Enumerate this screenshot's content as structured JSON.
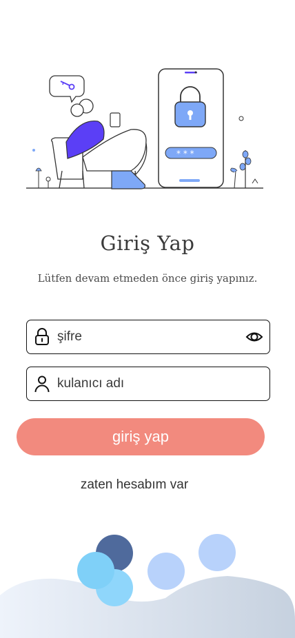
{
  "login": {
    "title": "Giriş Yap",
    "subtitle": "Lütfen devam etmeden önce giriş yapınız.",
    "password_placeholder": "şifre",
    "username_placeholder": "kulanıcı adı",
    "submit_label": "giriş yap",
    "have_account_label": "zaten hesabım var"
  },
  "icons": {
    "password": "lock-icon",
    "visibility": "eye-icon",
    "username": "user-icon"
  },
  "colors": {
    "primary_button": "#f28a7e",
    "illustration_accent": "#5b3ff6",
    "illustration_blue": "#7ea8f7",
    "border": "#111111"
  }
}
